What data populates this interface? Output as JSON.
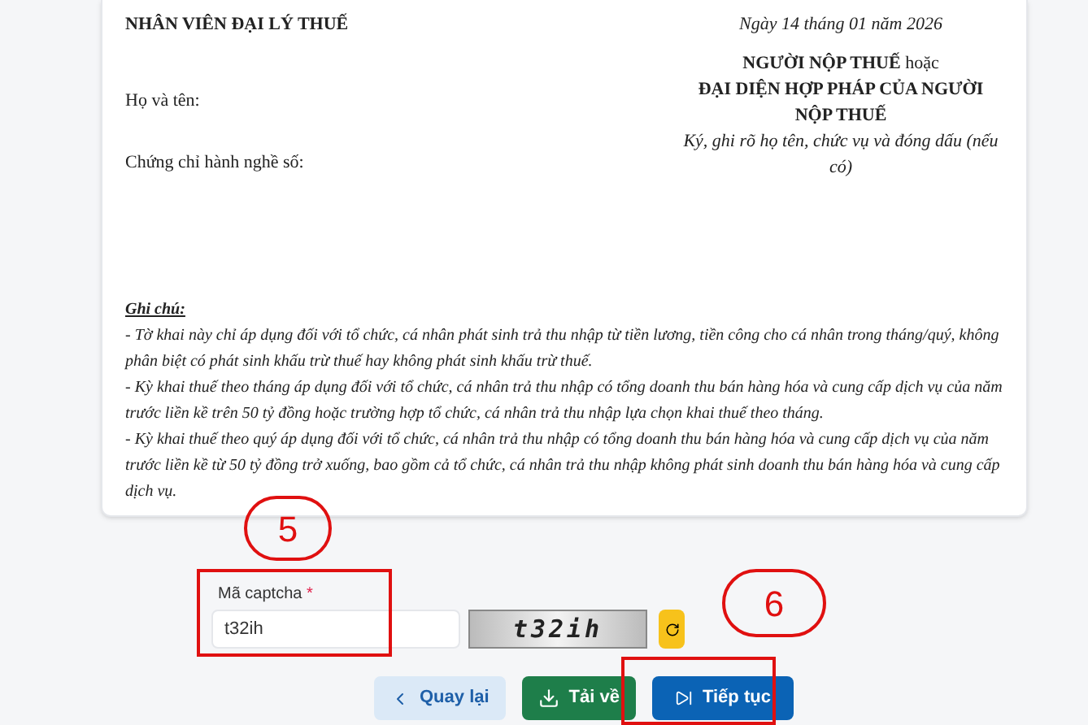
{
  "signature": {
    "agent_title": "NHÂN VIÊN ĐẠI LÝ THUẾ",
    "date": "Ngày 14 tháng 01 năm 2026",
    "name_label": "Họ và tên:",
    "cert_label": "Chứng chỉ hành nghề số:",
    "taxpayer_line1": "NGƯỜI NỘP THUẾ",
    "taxpayer_or": "hoặc",
    "taxpayer_line2": "ĐẠI DIỆN HỢP PHÁP CỦA NGƯỜI NỘP THUẾ",
    "sign_hint": "Ký, ghi rõ họ tên, chức vụ và đóng dấu (nếu có)"
  },
  "notes": {
    "title": "Ghi chú:",
    "lines": [
      "- Tờ khai này chỉ áp dụng đối với tổ chức, cá nhân phát sinh trả thu nhập từ tiền lương, tiền công cho cá nhân trong tháng/quý, không phân biệt có phát sinh khấu trừ thuế hay không phát sinh khấu trừ thuế.",
      "- Kỳ khai thuế theo tháng áp dụng đối với tổ chức, cá nhân trả thu nhập có tổng doanh thu bán hàng hóa và cung cấp dịch vụ của năm trước liền kề trên 50 tỷ đồng hoặc trường hợp tổ chức, cá nhân trả thu nhập lựa chọn khai thuế theo tháng.",
      "- Kỳ khai thuế theo quý áp dụng đối với tổ chức, cá nhân trả thu nhập có tổng doanh thu bán hàng hóa và cung cấp dịch vụ của năm trước liền kề từ 50 tỷ đồng trở xuống, bao gồm cả tổ chức, cá nhân trả thu nhập không phát sinh doanh thu bán hàng hóa và cung cấp dịch vụ."
    ]
  },
  "captcha": {
    "label": "Mã captcha",
    "required_mark": "*",
    "value": "t32ih",
    "image_text": "t32ih"
  },
  "buttons": [
    {
      "kind": "back",
      "label": "Quay lại"
    },
    {
      "kind": "download",
      "label": "Tải về"
    },
    {
      "kind": "next",
      "label": "Tiếp tục"
    }
  ],
  "annotations": [
    {
      "label": "5"
    },
    {
      "label": "6"
    }
  ]
}
